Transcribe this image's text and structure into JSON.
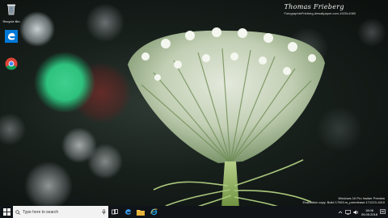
{
  "desktop": {
    "icons": [
      {
        "name": "recycle-bin",
        "label": "Recycle Bin"
      },
      {
        "name": "edge",
        "label": ""
      },
      {
        "name": "chrome",
        "label": ""
      }
    ],
    "watermark": {
      "name": "Thomas Frieberg",
      "url": "FotographieFrieberg.dewallpaper.com-1920x1080"
    },
    "evaluation": {
      "line1": "Windows 10 Pro Insider Preview",
      "line2": "Evaluation copy. Build 17063.rs_prerelease.171213-1610"
    }
  },
  "taskbar": {
    "search_placeholder": "Type here to search",
    "clock_time": "18:06",
    "clock_date": "05.05.2018"
  },
  "colors": {
    "taskbar_bg": "#101418",
    "search_bg": "#f2f2f2",
    "accent_blue": "#0078d7",
    "bokeh_green": "#2ec27e"
  }
}
